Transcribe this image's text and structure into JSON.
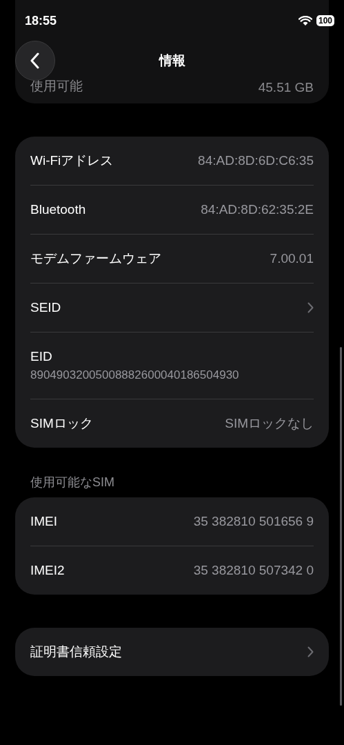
{
  "status_bar": {
    "time": "18:55",
    "battery": "100"
  },
  "nav": {
    "title": "情報"
  },
  "faded_row": {
    "label": "使用可能",
    "value": "45.51 GB"
  },
  "groups": [
    {
      "rows": [
        {
          "kind": "value",
          "label": "Wi-Fiアドレス",
          "value": "84:AD:8D:6D:C6:35"
        },
        {
          "kind": "value",
          "label": "Bluetooth",
          "value": "84:AD:8D:62:35:2E"
        },
        {
          "kind": "value",
          "label": "モデムファームウェア",
          "value": "7.00.01"
        },
        {
          "kind": "chevron",
          "label": "SEID"
        },
        {
          "kind": "stacked",
          "label": "EID",
          "value": "89049032005008882600040186504930"
        },
        {
          "kind": "value",
          "label": "SIMロック",
          "value": "SIMロックなし"
        }
      ]
    },
    {
      "header": "使用可能なSIM",
      "rows": [
        {
          "kind": "value",
          "label": "IMEI",
          "value": "35 382810 501656 9"
        },
        {
          "kind": "value",
          "label": "IMEI2",
          "value": "35 382810 507342 0"
        }
      ]
    },
    {
      "rows": [
        {
          "kind": "chevron",
          "label": "証明書信頼設定"
        }
      ]
    }
  ]
}
